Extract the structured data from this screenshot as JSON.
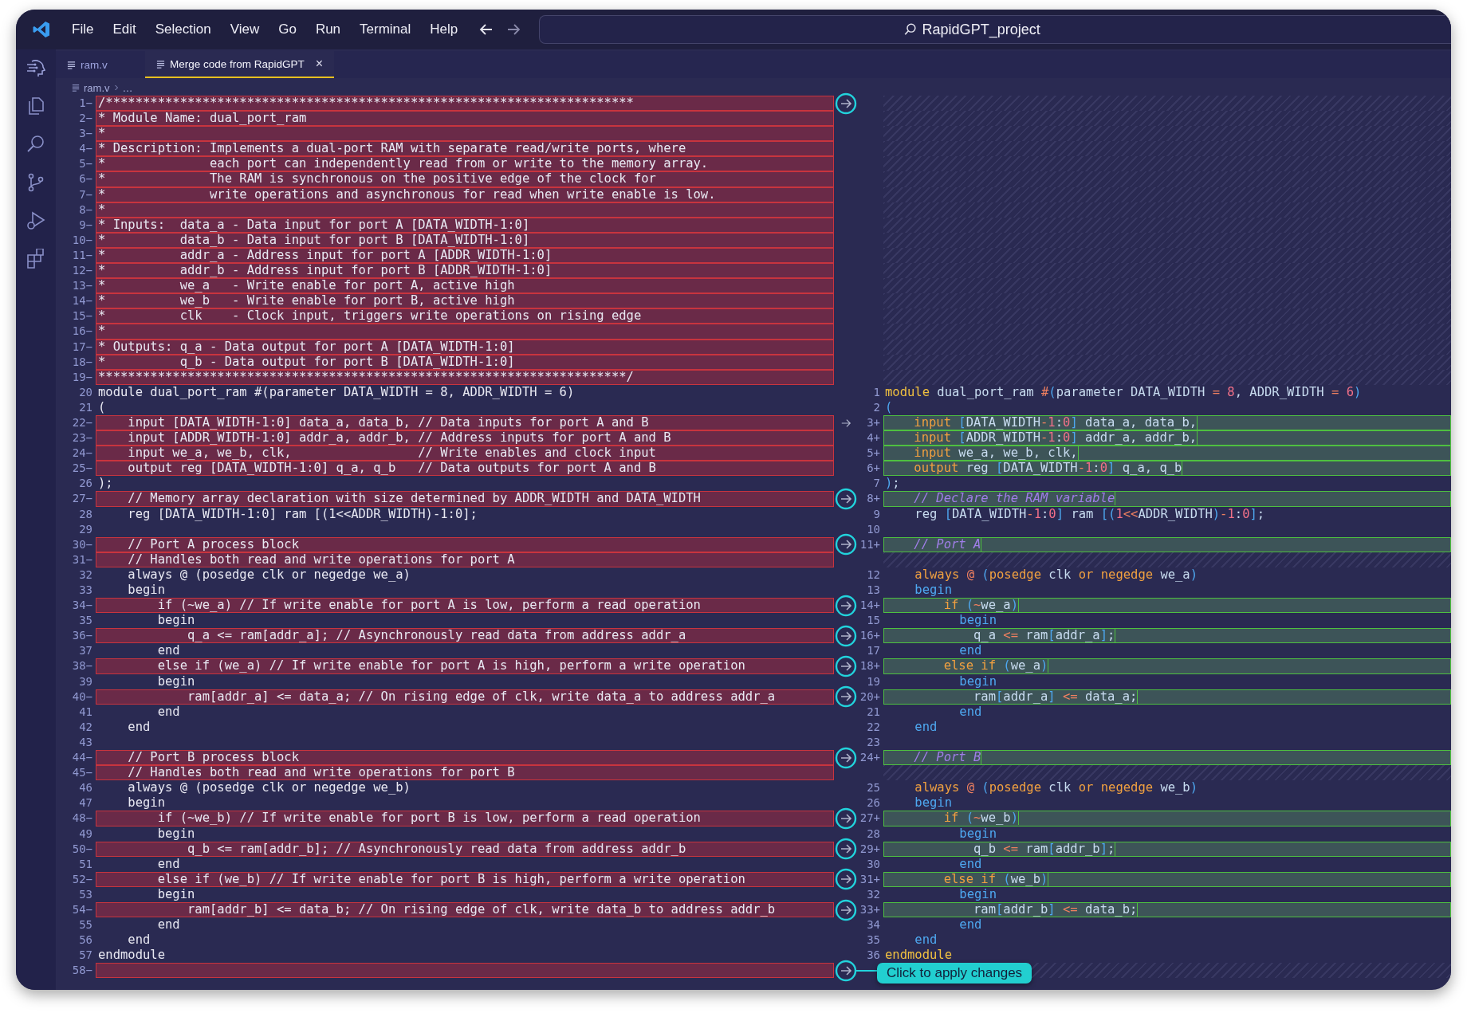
{
  "menu": [
    "File",
    "Edit",
    "Selection",
    "View",
    "Go",
    "Run",
    "Terminal",
    "Help"
  ],
  "search": {
    "value": "RapidGPT_project"
  },
  "tabs": [
    {
      "label": "ram.v",
      "selected": false,
      "closable": false
    },
    {
      "label": "Merge code from RapidGPT",
      "selected": true,
      "closable": true
    }
  ],
  "close_glyph": "×",
  "breadcrumb": [
    "ram.v",
    "…"
  ],
  "rows": [
    {
      "left": {
        "number": "1",
        "sign": "−",
        "removed": true,
        "code": "/***********************************************************************"
      },
      "apply": {
        "kind": "circle"
      }
    },
    {
      "left": {
        "number": "2",
        "sign": "−",
        "removed": true,
        "code": "* Module Name: dual_port_ram"
      }
    },
    {
      "left": {
        "number": "3",
        "sign": "−",
        "removed": true,
        "code": "*"
      }
    },
    {
      "left": {
        "number": "4",
        "sign": "−",
        "removed": true,
        "code": "* Description: Implements a dual-port RAM with separate read/write ports, where"
      }
    },
    {
      "left": {
        "number": "5",
        "sign": "−",
        "removed": true,
        "code": "*              each port can independently read from or write to the memory array."
      }
    },
    {
      "left": {
        "number": "6",
        "sign": "−",
        "removed": true,
        "code": "*              The RAM is synchronous on the positive edge of the clock for"
      }
    },
    {
      "left": {
        "number": "7",
        "sign": "−",
        "removed": true,
        "code": "*              write operations and asynchronous for read when write enable is low."
      }
    },
    {
      "left": {
        "number": "8",
        "sign": "−",
        "removed": true,
        "code": "*"
      }
    },
    {
      "left": {
        "number": "9",
        "sign": "−",
        "removed": true,
        "code": "* Inputs:  data_a - Data input for port A [DATA_WIDTH-1:0]"
      }
    },
    {
      "left": {
        "number": "10",
        "sign": "−",
        "removed": true,
        "code": "*          data_b - Data input for port B [DATA_WIDTH-1:0]"
      }
    },
    {
      "left": {
        "number": "11",
        "sign": "−",
        "removed": true,
        "code": "*          addr_a - Address input for port A [ADDR_WIDTH-1:0]"
      }
    },
    {
      "left": {
        "number": "12",
        "sign": "−",
        "removed": true,
        "code": "*          addr_b - Address input for port B [ADDR_WIDTH-1:0]"
      }
    },
    {
      "left": {
        "number": "13",
        "sign": "−",
        "removed": true,
        "code": "*          we_a   - Write enable for port A, active high"
      }
    },
    {
      "left": {
        "number": "14",
        "sign": "−",
        "removed": true,
        "code": "*          we_b   - Write enable for port B, active high"
      }
    },
    {
      "left": {
        "number": "15",
        "sign": "−",
        "removed": true,
        "code": "*          clk    - Clock input, triggers write operations on rising edge"
      }
    },
    {
      "left": {
        "number": "16",
        "sign": "−",
        "removed": true,
        "code": "*"
      }
    },
    {
      "left": {
        "number": "17",
        "sign": "−",
        "removed": true,
        "code": "* Outputs: q_a - Data output for port A [DATA_WIDTH-1:0]"
      }
    },
    {
      "left": {
        "number": "18",
        "sign": "−",
        "removed": true,
        "code": "*          q_b - Data output for port B [DATA_WIDTH-1:0]"
      }
    },
    {
      "left": {
        "number": "19",
        "sign": "−",
        "removed": true,
        "code": "***********************************************************************/"
      }
    },
    {
      "left": {
        "number": "20",
        "removed": false,
        "code": "module dual_port_ram #(parameter DATA_WIDTH = 8, ADDR_WIDTH = 6)"
      },
      "right": {
        "number": "1",
        "added": false,
        "code": "module dual_port_ram #(parameter DATA_WIDTH = 8, ADDR_WIDTH = 6)"
      }
    },
    {
      "left": {
        "number": "21",
        "removed": false,
        "code": "("
      },
      "right": {
        "number": "2",
        "added": false,
        "code": "("
      }
    },
    {
      "left": {
        "number": "22",
        "sign": "−",
        "removed": true,
        "code": "    input [DATA_WIDTH-1:0] data_a, data_b, // Data inputs for port A and B"
      },
      "apply": {
        "kind": "arrow"
      },
      "right": {
        "number": "3",
        "sign": "+",
        "added": true,
        "code": "    input [DATA_WIDTH-1:0] data_a, data_b,"
      }
    },
    {
      "left": {
        "number": "23",
        "sign": "−",
        "removed": true,
        "code": "    input [ADDR_WIDTH-1:0] addr_a, addr_b, // Address inputs for port A and B"
      },
      "right": {
        "number": "4",
        "sign": "+",
        "added": true,
        "code": "    input [ADDR_WIDTH-1:0] addr_a, addr_b,"
      }
    },
    {
      "left": {
        "number": "24",
        "sign": "−",
        "removed": true,
        "code": "    input we_a, we_b, clk,                 // Write enables and clock input"
      },
      "right": {
        "number": "5",
        "sign": "+",
        "added": true,
        "code": "    input we_a, we_b, clk,"
      }
    },
    {
      "left": {
        "number": "25",
        "sign": "−",
        "removed": true,
        "code": "    output reg [DATA_WIDTH-1:0] q_a, q_b   // Data outputs for port A and B"
      },
      "right": {
        "number": "6",
        "sign": "+",
        "added": true,
        "code": "    output reg [DATA_WIDTH-1:0] q_a, q_b"
      }
    },
    {
      "left": {
        "number": "26",
        "removed": false,
        "code": ");"
      },
      "right": {
        "number": "7",
        "added": false,
        "code": ");"
      }
    },
    {
      "left": {
        "number": "27",
        "sign": "−",
        "removed": true,
        "code": "    // Memory array declaration with size determined by ADDR_WIDTH and DATA_WIDTH"
      },
      "apply": {
        "kind": "circle"
      },
      "right": {
        "number": "8",
        "sign": "+",
        "added": true,
        "code": "    // Declare the RAM variable"
      }
    },
    {
      "left": {
        "number": "28",
        "removed": false,
        "code": "    reg [DATA_WIDTH-1:0] ram [(1<<ADDR_WIDTH)-1:0];"
      },
      "right": {
        "number": "9",
        "added": false,
        "code": "    reg [DATA_WIDTH-1:0] ram [(1<<ADDR_WIDTH)-1:0];"
      }
    },
    {
      "left": {
        "number": "29",
        "removed": false
      },
      "right": {
        "number": "10",
        "added": false
      }
    },
    {
      "left": {
        "number": "30",
        "sign": "−",
        "removed": true,
        "code": "    // Port A process block"
      },
      "apply": {
        "kind": "circle"
      },
      "right": {
        "number": "11",
        "sign": "+",
        "added": true,
        "code": "    // Port A"
      }
    },
    {
      "left": {
        "number": "31",
        "sign": "−",
        "removed": true,
        "code": "    // Handles both read and write operations for port A"
      }
    },
    {
      "left": {
        "number": "32",
        "removed": false,
        "code": "    always @ (posedge clk or negedge we_a)"
      },
      "right": {
        "number": "12",
        "added": false,
        "code": "    always @ (posedge clk or negedge we_a)"
      }
    },
    {
      "left": {
        "number": "33",
        "removed": false,
        "code": "    begin"
      },
      "right": {
        "number": "13",
        "added": false,
        "code": "    begin"
      }
    },
    {
      "left": {
        "number": "34",
        "sign": "−",
        "removed": true,
        "code": "        if (~we_a) // If write enable for port A is low, perform a read operation"
      },
      "apply": {
        "kind": "circle"
      },
      "right": {
        "number": "14",
        "sign": "+",
        "added": true,
        "code": "        if (~we_a)"
      }
    },
    {
      "left": {
        "number": "35",
        "removed": false,
        "code": "        begin"
      },
      "right": {
        "number": "15",
        "added": false,
        "code": "          begin"
      }
    },
    {
      "left": {
        "number": "36",
        "sign": "−",
        "removed": true,
        "code": "            q_a <= ram[addr_a]; // Asynchronously read data from address addr_a"
      },
      "apply": {
        "kind": "circle"
      },
      "right": {
        "number": "16",
        "sign": "+",
        "added": true,
        "code": "            q_a <= ram[addr_a];"
      }
    },
    {
      "left": {
        "number": "37",
        "removed": false,
        "code": "        end"
      },
      "right": {
        "number": "17",
        "added": false,
        "code": "          end"
      }
    },
    {
      "left": {
        "number": "38",
        "sign": "−",
        "removed": true,
        "code": "        else if (we_a) // If write enable for port A is high, perform a write operation"
      },
      "apply": {
        "kind": "circle"
      },
      "right": {
        "number": "18",
        "sign": "+",
        "added": true,
        "code": "        else if (we_a)"
      }
    },
    {
      "left": {
        "number": "39",
        "removed": false,
        "code": "        begin"
      },
      "right": {
        "number": "19",
        "added": false,
        "code": "          begin"
      }
    },
    {
      "left": {
        "number": "40",
        "sign": "−",
        "removed": true,
        "code": "            ram[addr_a] <= data_a; // On rising edge of clk, write data_a to address addr_a"
      },
      "apply": {
        "kind": "circle"
      },
      "right": {
        "number": "20",
        "sign": "+",
        "added": true,
        "code": "            ram[addr_a] <= data_a;"
      }
    },
    {
      "left": {
        "number": "41",
        "removed": false,
        "code": "        end"
      },
      "right": {
        "number": "21",
        "added": false,
        "code": "          end"
      }
    },
    {
      "left": {
        "number": "42",
        "removed": false,
        "code": "    end"
      },
      "right": {
        "number": "22",
        "added": false,
        "code": "    end"
      }
    },
    {
      "left": {
        "number": "43",
        "removed": false
      },
      "right": {
        "number": "23",
        "added": false
      }
    },
    {
      "left": {
        "number": "44",
        "sign": "−",
        "removed": true,
        "code": "    // Port B process block"
      },
      "apply": {
        "kind": "circle"
      },
      "right": {
        "number": "24",
        "sign": "+",
        "added": true,
        "code": "    // Port B"
      }
    },
    {
      "left": {
        "number": "45",
        "sign": "−",
        "removed": true,
        "code": "    // Handles both read and write operations for port B"
      }
    },
    {
      "left": {
        "number": "46",
        "removed": false,
        "code": "    always @ (posedge clk or negedge we_b)"
      },
      "right": {
        "number": "25",
        "added": false,
        "code": "    always @ (posedge clk or negedge we_b)"
      }
    },
    {
      "left": {
        "number": "47",
        "removed": false,
        "code": "    begin"
      },
      "right": {
        "number": "26",
        "added": false,
        "code": "    begin"
      }
    },
    {
      "left": {
        "number": "48",
        "sign": "−",
        "removed": true,
        "code": "        if (~we_b) // If write enable for port B is low, perform a read operation"
      },
      "apply": {
        "kind": "circle"
      },
      "right": {
        "number": "27",
        "sign": "+",
        "added": true,
        "code": "        if (~we_b)"
      }
    },
    {
      "left": {
        "number": "49",
        "removed": false,
        "code": "        begin"
      },
      "right": {
        "number": "28",
        "added": false,
        "code": "          begin"
      }
    },
    {
      "left": {
        "number": "50",
        "sign": "−",
        "removed": true,
        "code": "            q_b <= ram[addr_b]; // Asynchronously read data from address addr_b"
      },
      "apply": {
        "kind": "circle"
      },
      "right": {
        "number": "29",
        "sign": "+",
        "added": true,
        "code": "            q_b <= ram[addr_b];"
      }
    },
    {
      "left": {
        "number": "51",
        "removed": false,
        "code": "        end"
      },
      "right": {
        "number": "30",
        "added": false,
        "code": "          end"
      }
    },
    {
      "left": {
        "number": "52",
        "sign": "−",
        "removed": true,
        "code": "        else if (we_b) // If write enable for port B is high, perform a write operation"
      },
      "apply": {
        "kind": "circle"
      },
      "right": {
        "number": "31",
        "sign": "+",
        "added": true,
        "code": "        else if (we_b)"
      }
    },
    {
      "left": {
        "number": "53",
        "removed": false,
        "code": "        begin"
      },
      "right": {
        "number": "32",
        "added": false,
        "code": "          begin"
      }
    },
    {
      "left": {
        "number": "54",
        "sign": "−",
        "removed": true,
        "code": "            ram[addr_b] <= data_b; // On rising edge of clk, write data_b to address addr_b"
      },
      "apply": {
        "kind": "circle"
      },
      "right": {
        "number": "33",
        "sign": "+",
        "added": true,
        "code": "            ram[addr_b] <= data_b;"
      }
    },
    {
      "left": {
        "number": "55",
        "removed": false,
        "code": "        end"
      },
      "right": {
        "number": "34",
        "added": false,
        "code": "          end"
      }
    },
    {
      "left": {
        "number": "56",
        "removed": false,
        "code": "    end"
      },
      "right": {
        "number": "35",
        "added": false,
        "code": "    end"
      }
    },
    {
      "left": {
        "number": "57",
        "removed": false,
        "code": "endmodule"
      },
      "right": {
        "number": "36",
        "added": false,
        "code": "endmodule"
      }
    },
    {
      "left": {
        "number": "58",
        "sign": "−",
        "removed": true
      },
      "apply": {
        "kind": "circle"
      },
      "tooltip": "Click to apply changes"
    }
  ]
}
